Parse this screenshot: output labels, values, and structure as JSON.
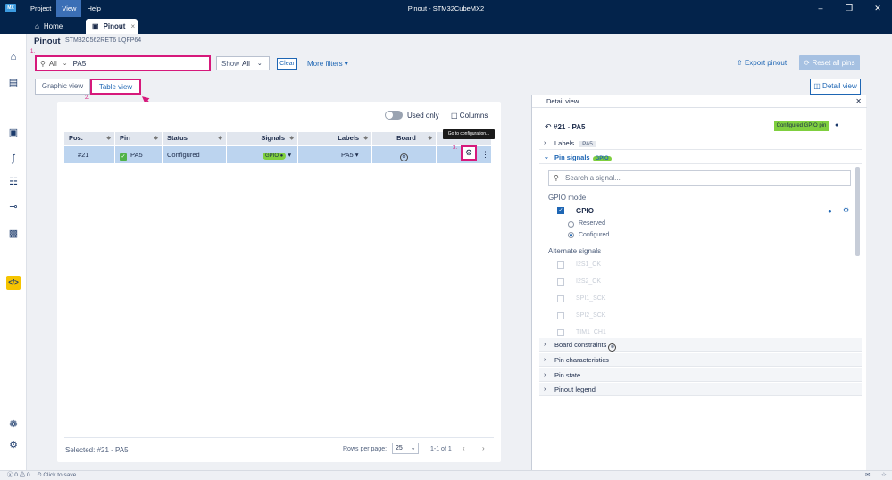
{
  "titlebar": {
    "logo": "MX",
    "menu": [
      "Project",
      "View",
      "Help"
    ],
    "title": "Pinout - STM32CubeMX2"
  },
  "tabs": {
    "home": "Home",
    "pinout": "Pinout"
  },
  "header": {
    "title": "Pinout",
    "subtitle": "STM32C562RET6 LQFP64"
  },
  "filter": {
    "scope": "All",
    "value": "PA5",
    "step": "1."
  },
  "show": {
    "label": "Show",
    "value": "All"
  },
  "clear_label": "Clear",
  "more_filters_label": "More filters",
  "export_label": "Export pinout",
  "reset_label": "Reset all pins",
  "view_tabs": {
    "graphic": "Graphic view",
    "table": "Table view",
    "step": "2."
  },
  "detail_view_label": "Detail view",
  "table": {
    "used_only_label": "Used only",
    "columns_label": "Columns",
    "headers": [
      "Pos.",
      "Pin",
      "Status",
      "Signals",
      "Labels",
      "Board"
    ],
    "row": {
      "pos": "#21",
      "pin": "PA5",
      "status": "Configured",
      "signal": "GPIO",
      "label": "PA5"
    },
    "tooltip": "Go to configuration...",
    "step": "3.",
    "selected": "Selected: #21 - PA5",
    "rows_per_page_label": "Rows per page:",
    "rows_per_page": "25",
    "range": "1-1 of 1"
  },
  "detail": {
    "title": "Detail view",
    "pin": "#21 - PA5",
    "badge": "Configured GPIO pin",
    "labels_section": "Labels",
    "labels_value": "PA5",
    "pin_signals": "Pin signals",
    "pin_signals_chip": "GPIO",
    "search_placeholder": "Search a signal...",
    "gpio_mode": "GPIO mode",
    "gpio": "GPIO",
    "reserved": "Reserved",
    "configured": "Configured",
    "alternate": "Alternate signals",
    "alt_signals": [
      "I2S1_CK",
      "I2S2_CK",
      "SPI1_SCK",
      "SPI2_SCK",
      "TIM1_CH1"
    ],
    "board_constraints": "Board constraints",
    "pin_characteristics": "Pin characteristics",
    "pin_state": "Pin state",
    "pinout_legend": "Pinout legend"
  },
  "status": {
    "counts": "ⓧ 0 ⚠ 0",
    "save": "Click to save"
  }
}
